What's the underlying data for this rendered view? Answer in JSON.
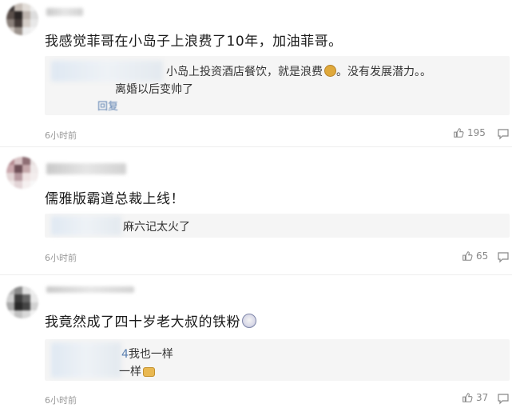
{
  "comments": [
    {
      "text": "我感觉菲哥在小岛子上浪费了10年，加油菲哥。",
      "replies": [
        {
          "text": "小岛上投资酒店餐饮，就是浪费",
          "suffix": "。没有发展潜力。。",
          "emoji": "money-bag"
        },
        {
          "text": "离婚以后变帅了"
        }
      ],
      "reply_link": "回复",
      "time": "6小时前",
      "likes": "195"
    },
    {
      "text": "儒雅版霸道总裁上线！",
      "replies": [
        {
          "text": "麻六记太火了"
        }
      ],
      "time": "6小时前",
      "likes": "65"
    },
    {
      "text": "我竟然成了四十岁老大叔的铁粉",
      "emoji": "laughing-face",
      "replies": [
        {
          "prefix": "4",
          "text": "我也一样"
        },
        {
          "text": "一样",
          "emoji": "handshake"
        }
      ],
      "time": "6小时前",
      "likes": "37"
    }
  ],
  "colors": {
    "background": "#ffffff",
    "reply_box": "#f5f5f5",
    "meta_text": "#999999",
    "emoji_gold": "#e0a93b"
  }
}
